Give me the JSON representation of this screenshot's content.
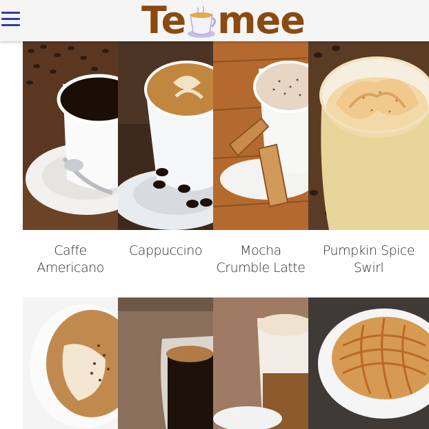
{
  "header": {
    "menu_icon": "hamburger-menu-icon",
    "logo_left": "Te",
    "logo_right": "mee",
    "logo_icon": "tea-cup-icon",
    "brand_color": "#8a4a12",
    "accent_color": "#2f3aa8"
  },
  "products": [
    {
      "label": "Caffe Americano"
    },
    {
      "label": "Cappuccino"
    },
    {
      "label": "Mocha Crumble Latte"
    },
    {
      "label": "Pumpkin Spice Swirl"
    }
  ]
}
